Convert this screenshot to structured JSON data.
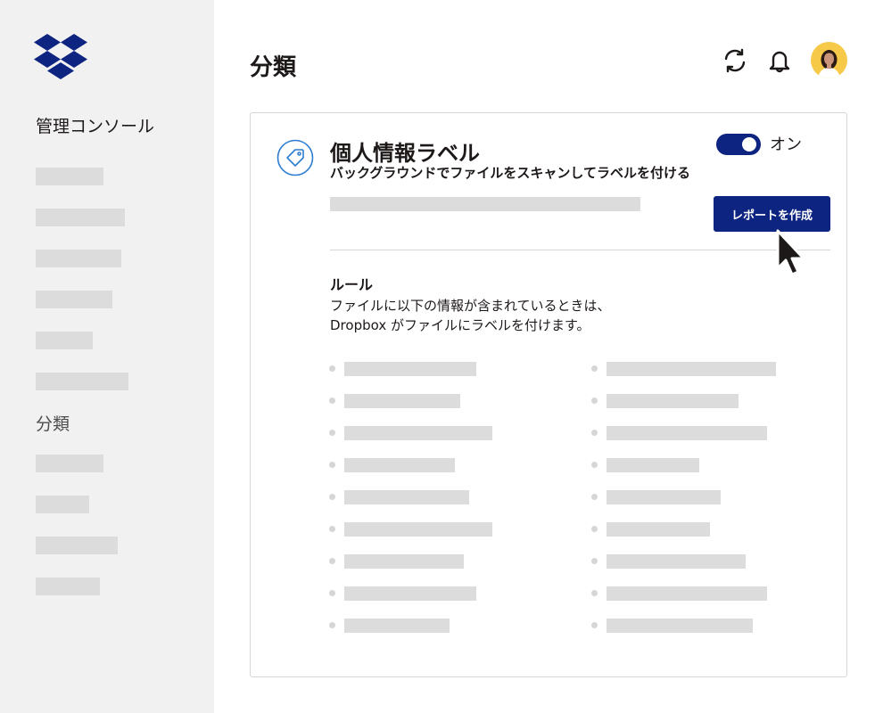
{
  "sidebar": {
    "title": "管理コンソール",
    "section_label": "分類",
    "logo_icon": "dropbox-logo",
    "brand_color": "#0d2481"
  },
  "header": {
    "page_title": "分類",
    "icons": [
      "sync-icon",
      "bell-icon"
    ],
    "avatar": "user-avatar"
  },
  "card": {
    "title": "個人情報ラベル",
    "subtitle": "バックグラウンドでファイルをスキャンしてラベルを付ける",
    "toggle_label": "オン",
    "toggle_on": true,
    "report_button": "レポートを作成",
    "rule_heading": "ルール",
    "rule_desc_line1": "ファイルに以下の情報が含まれているときは、",
    "rule_desc_line2": "Dropbox がファイルにラベルを付けます。",
    "icon": "tag-icon",
    "accent_color": "#0d2481"
  }
}
